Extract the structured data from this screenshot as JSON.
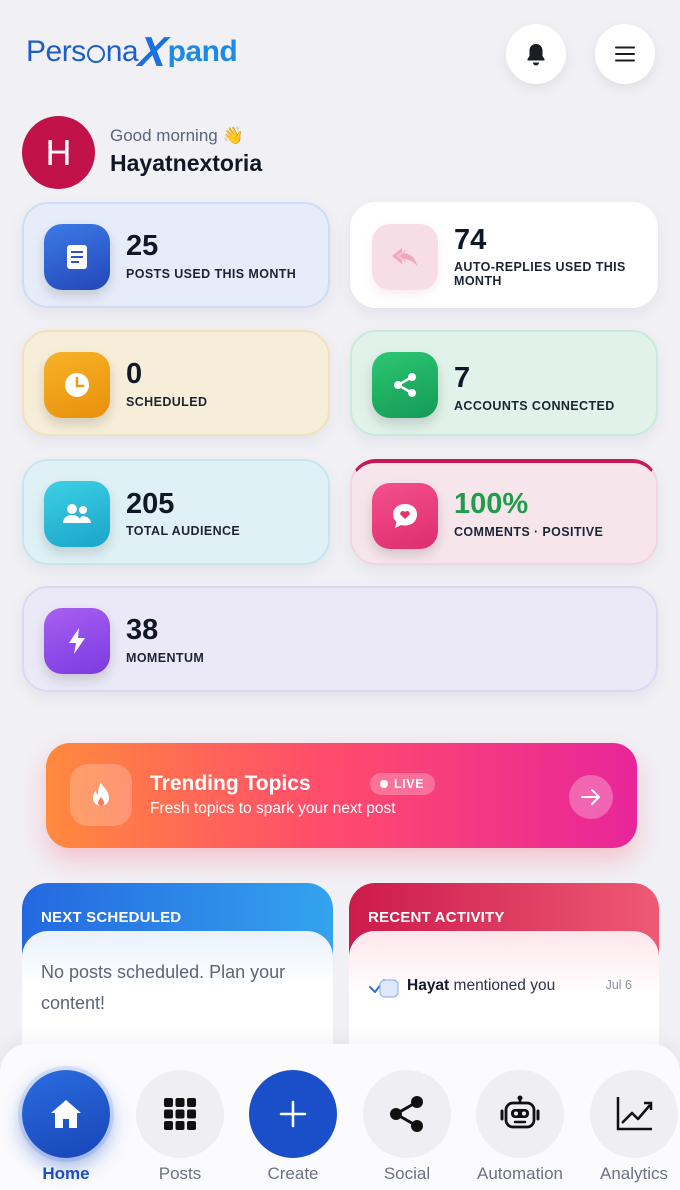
{
  "header": {
    "logo": {
      "part1": "Pers",
      "part1b": "na",
      "x": "X",
      "part2": "pand"
    },
    "icons": {
      "bell": "bell-icon",
      "menu": "hamburger-menu-icon"
    }
  },
  "user": {
    "avatar_initial": "H",
    "greeting": "Good morning",
    "greeting_emoji": "👋",
    "name": "Hayatnextoria"
  },
  "stats": {
    "posts": {
      "value": "25",
      "label": "POSTS USED THIS MONTH",
      "icon": "document-icon"
    },
    "auto_replies": {
      "value": "74",
      "label": "AUTO-REPLIES USED THIS MONTH",
      "icon": "reply-all-icon"
    },
    "scheduled": {
      "value": "0",
      "label": "SCHEDULED",
      "icon": "clock-icon"
    },
    "accounts": {
      "value": "7",
      "label": "ACCOUNTS CONNECTED",
      "icon": "share-icon"
    },
    "audience": {
      "value": "205",
      "label": "TOTAL AUDIENCE",
      "icon": "users-icon"
    },
    "comments": {
      "value": "100%",
      "label": "COMMENTS · POSITIVE",
      "icon": "chat-heart-icon",
      "value_color": "#1f9d4a"
    },
    "momentum": {
      "value": "38",
      "label": "MOMENTUM",
      "icon": "lightning-icon"
    }
  },
  "trending": {
    "title": "Trending Topics",
    "badge": "LIVE",
    "subtitle": "Fresh topics to spark your next post",
    "icon": "fire-icon"
  },
  "next_scheduled": {
    "title": "NEXT SCHEDULED",
    "empty_text": "No posts scheduled. Plan your content!"
  },
  "recent_activity": {
    "title": "RECENT ACTIVITY",
    "items": [
      {
        "user": "Hayat",
        "text": "mentioned you",
        "date": "Jul 6"
      }
    ]
  },
  "nav": {
    "items": [
      {
        "label": "Home",
        "icon": "home-icon",
        "active": true
      },
      {
        "label": "Posts",
        "icon": "grid-icon"
      },
      {
        "label": "Create",
        "icon": "plus-icon"
      },
      {
        "label": "Social",
        "icon": "share-icon"
      },
      {
        "label": "Automation",
        "icon": "robot-icon"
      },
      {
        "label": "Analytics",
        "icon": "chart-line-icon"
      }
    ]
  }
}
